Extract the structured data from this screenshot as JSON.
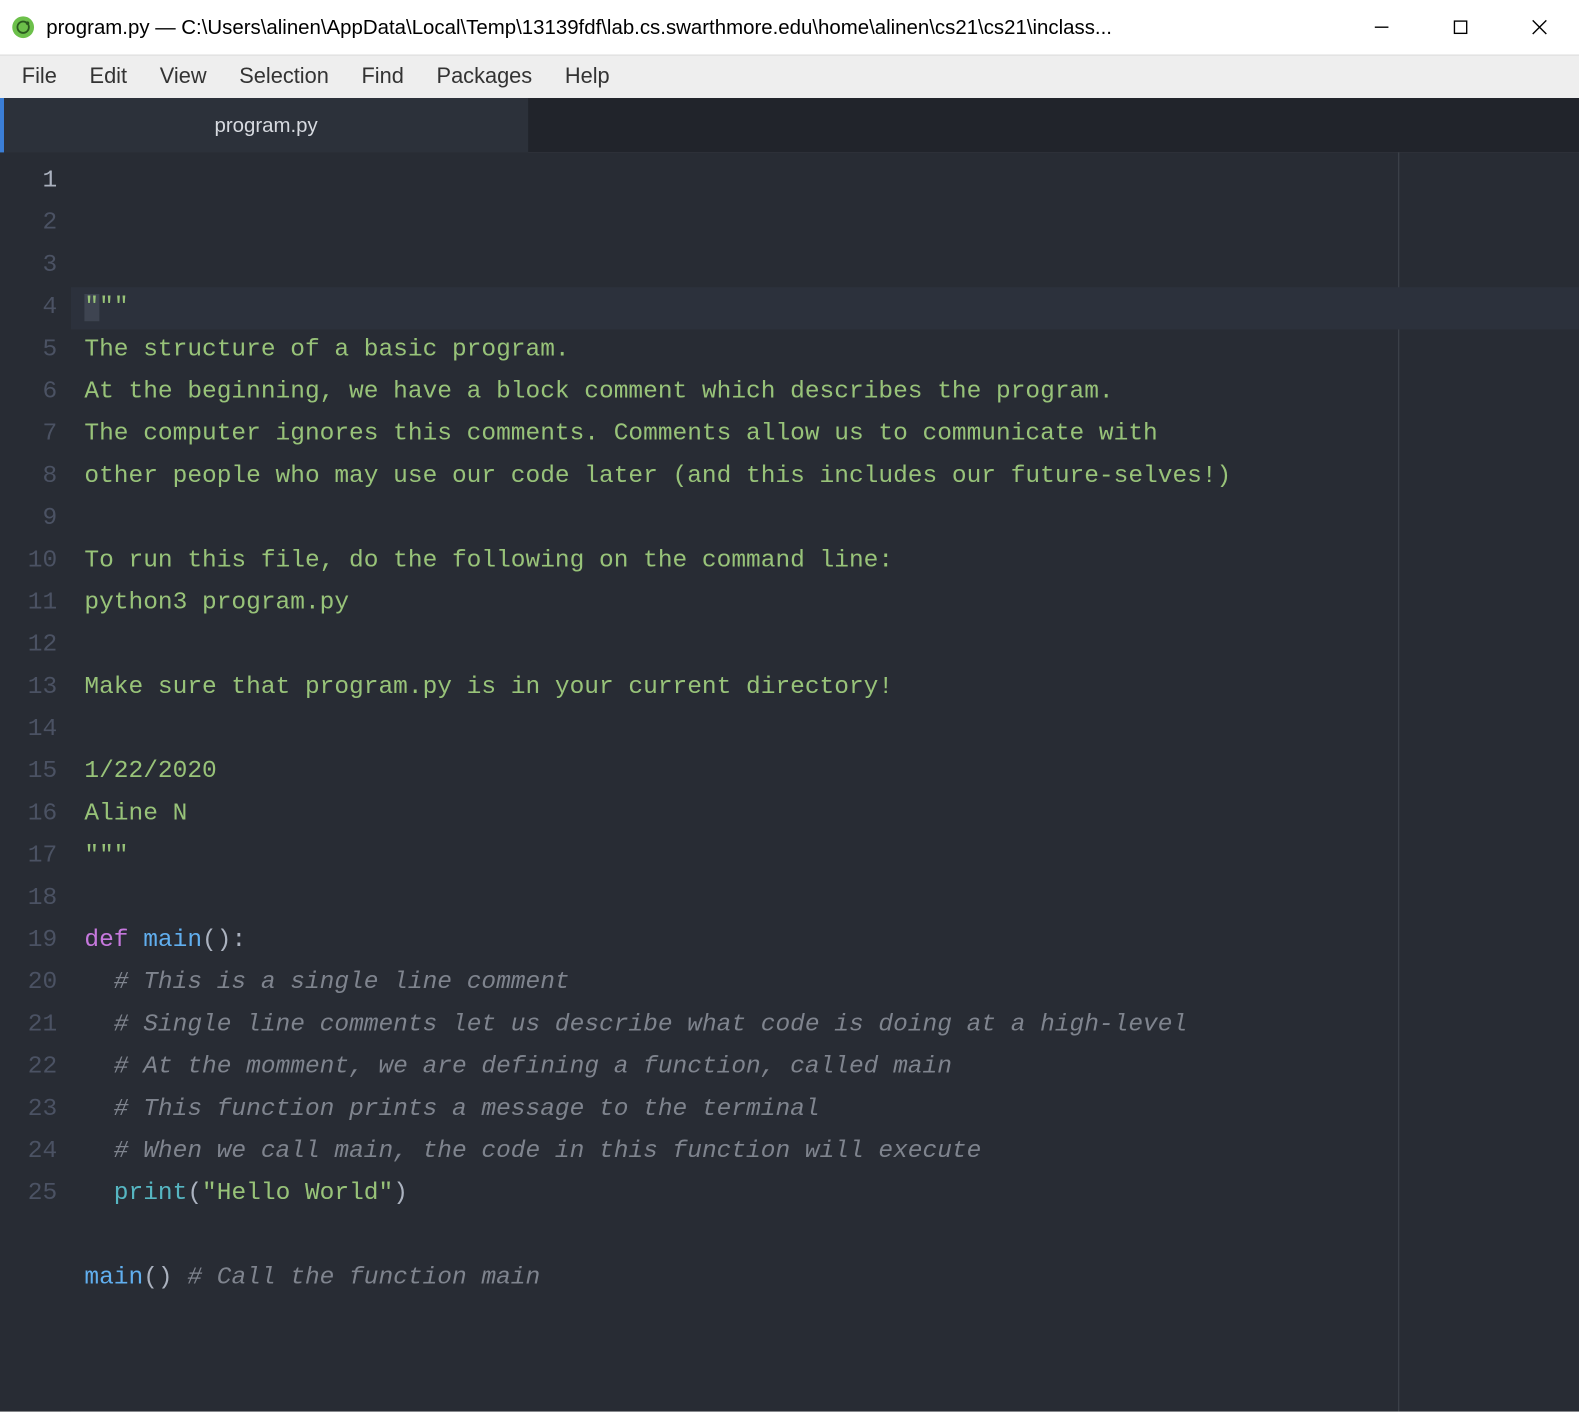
{
  "titlebar": {
    "title": "program.py — C:\\Users\\alinen\\AppData\\Local\\Temp\\13139fdf\\lab.cs.swarthmore.edu\\home\\alinen\\cs21\\cs21\\inclass...",
    "minimize": "—",
    "maximize": "□",
    "close": "✕"
  },
  "menubar": {
    "items": [
      "File",
      "Edit",
      "View",
      "Selection",
      "Find",
      "Packages",
      "Help"
    ]
  },
  "tabs": [
    {
      "label": "program.py"
    }
  ],
  "editor": {
    "total_lines": 25,
    "current_line": 1,
    "lines": [
      {
        "segments": [
          {
            "cls": "cursor-sel",
            "t": "\""
          },
          {
            "cls": "c-str",
            "t": "\"\""
          }
        ]
      },
      {
        "segments": [
          {
            "cls": "c-str",
            "t": "The structure of a basic program."
          }
        ]
      },
      {
        "segments": [
          {
            "cls": "c-str",
            "t": "At the beginning, we have a block comment which describes the program."
          }
        ]
      },
      {
        "segments": [
          {
            "cls": "c-str",
            "t": "The computer ignores this comments. Comments allow us to communicate with"
          }
        ]
      },
      {
        "segments": [
          {
            "cls": "c-str",
            "t": "other people who may use our code later (and this includes our future-selves!)"
          }
        ]
      },
      {
        "segments": []
      },
      {
        "segments": [
          {
            "cls": "c-str",
            "t": "To run this file, do the following on the command line:"
          }
        ]
      },
      {
        "segments": [
          {
            "cls": "c-str",
            "t": "python3 program.py"
          }
        ]
      },
      {
        "segments": []
      },
      {
        "segments": [
          {
            "cls": "c-str",
            "t": "Make sure that program.py is in your current directory!"
          }
        ]
      },
      {
        "segments": []
      },
      {
        "segments": [
          {
            "cls": "c-str",
            "t": "1/22/2020"
          }
        ]
      },
      {
        "segments": [
          {
            "cls": "c-str",
            "t": "Aline N"
          }
        ]
      },
      {
        "segments": [
          {
            "cls": "c-str",
            "t": "\"\"\""
          }
        ]
      },
      {
        "segments": []
      },
      {
        "segments": [
          {
            "cls": "c-kw",
            "t": "def "
          },
          {
            "cls": "c-fn",
            "t": "main"
          },
          {
            "cls": "c-pl",
            "t": "():"
          }
        ]
      },
      {
        "segments": [
          {
            "cls": "c-pl",
            "t": "  "
          },
          {
            "cls": "c-cmt",
            "t": "# This is a single line comment"
          }
        ]
      },
      {
        "segments": [
          {
            "cls": "c-pl",
            "t": "  "
          },
          {
            "cls": "c-cmt",
            "t": "# Single line comments let us describe what code is doing at a high-level"
          }
        ]
      },
      {
        "segments": [
          {
            "cls": "c-pl",
            "t": "  "
          },
          {
            "cls": "c-cmt",
            "t": "# At the momment, we are defining a function, called main"
          }
        ]
      },
      {
        "segments": [
          {
            "cls": "c-pl",
            "t": "  "
          },
          {
            "cls": "c-cmt",
            "t": "# This function prints a message to the terminal"
          }
        ]
      },
      {
        "segments": [
          {
            "cls": "c-pl",
            "t": "  "
          },
          {
            "cls": "c-cmt",
            "t": "# When we call main, the code in this function will execute"
          }
        ]
      },
      {
        "segments": [
          {
            "cls": "c-pl",
            "t": "  "
          },
          {
            "cls": "c-bi",
            "t": "print"
          },
          {
            "cls": "c-pl",
            "t": "("
          },
          {
            "cls": "c-str",
            "t": "\"Hello World\""
          },
          {
            "cls": "c-pl",
            "t": ")"
          }
        ]
      },
      {
        "segments": []
      },
      {
        "segments": [
          {
            "cls": "c-fn",
            "t": "main"
          },
          {
            "cls": "c-pl",
            "t": "() "
          },
          {
            "cls": "c-cmt",
            "t": "# Call the function main"
          }
        ]
      },
      {
        "segments": []
      }
    ]
  }
}
